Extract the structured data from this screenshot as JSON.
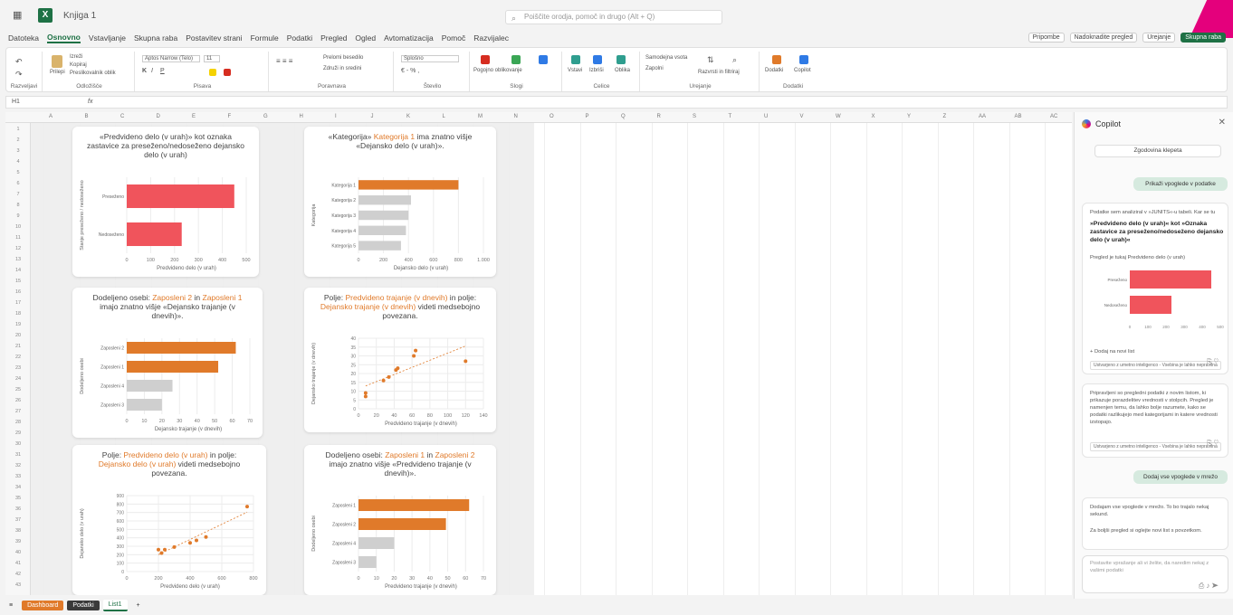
{
  "titlebar": {
    "title": "Knjiga 1",
    "search_placeholder": "Poiščite orodja, pomoč in drugo (Alt + Q)"
  },
  "menu": [
    "Datoteka",
    "Osnovno",
    "Vstavljanje",
    "Skupna raba",
    "Postavitev strani",
    "Formule",
    "Podatki",
    "Pregled",
    "Ogled",
    "Avtomatizacija",
    "Pomoč",
    "Razvijalec"
  ],
  "menu_right": {
    "comments": "Pripombe",
    "catchup": "Nadoknadite pregled",
    "editing": "Urejanje",
    "share": "Skupna raba"
  },
  "ribbon": {
    "groups": [
      "Razveljavi",
      "Odložišče",
      "Pisava",
      "Poravnava",
      "Število",
      "Slogi",
      "Celice",
      "Urejanje",
      "Dodatki"
    ],
    "font_name": "Aptos Narrow (Telo)",
    "font_size": "11",
    "number_format": "Splošno",
    "labels": {
      "paste": "Prilepi",
      "cut": "Izreži",
      "copy": "Kopiraj",
      "format_painter": "Preslikovalnik oblik",
      "wrap": "Prelomi besedilo",
      "merge": "Združi in sredini",
      "cond_format": "Pogojno oblikovanje",
      "format_table": "Oblikuj kot tabelo",
      "cell_styles": "Slogi celic",
      "insert": "Vstavi",
      "delete": "Izbriši",
      "format": "Oblika",
      "autosum": "Samodejna vsota",
      "fill": "Zapolni",
      "sort": "Razvrsti in filtriraj",
      "find": "Najdi in izberi",
      "addins": "Dodatki",
      "copilot": "Copilot"
    }
  },
  "formula_bar": {
    "cell_ref": "H1",
    "fx": "fx"
  },
  "columns": [
    "A",
    "B",
    "C",
    "D",
    "E",
    "F",
    "G",
    "H",
    "I",
    "J",
    "K",
    "L",
    "M",
    "N",
    "O",
    "P",
    "Q",
    "R",
    "S",
    "T",
    "U",
    "V",
    "W",
    "X",
    "Y",
    "Z",
    "AA",
    "AB",
    "AC"
  ],
  "charts": [
    {
      "title_parts": [
        {
          "t": "«Predvideno delo (v urah)» kot oznaka zastavice za preseženo/nedoseženo dejansko delo (v urah)",
          "hl": false
        }
      ],
      "type": "bar",
      "categories": [
        "Preseženo",
        "Nedoseženo"
      ],
      "values": [
        450,
        230
      ],
      "colors": [
        "#f0545c",
        "#f0545c"
      ],
      "xticks": [
        "0",
        "100",
        "200",
        "300",
        "400",
        "500"
      ],
      "xmax": 500,
      "xlabel": "Predvideno delo (v urah)",
      "ylabel": "Stanje preseženo / nedoseženo"
    },
    {
      "title_parts": [
        {
          "t": "«Kategorija» ",
          "hl": false
        },
        {
          "t": "Kategorija 1",
          "hl": true
        },
        {
          "t": " ima znatno višje «Dejansko delo (v urah)».",
          "hl": false
        }
      ],
      "type": "bar",
      "categories": [
        "Kategorija 1",
        "Kategorija 2",
        "Kategorija 3",
        "Kategorija 4",
        "Kategorija 5"
      ],
      "values": [
        800,
        420,
        400,
        380,
        340
      ],
      "colors": [
        "#e07a2a",
        "#cfcfcf",
        "#cfcfcf",
        "#cfcfcf",
        "#cfcfcf"
      ],
      "xticks": [
        "0",
        "200",
        "400",
        "600",
        "800",
        "1.000"
      ],
      "xmax": 1000,
      "xlabel": "Dejansko delo (v urah)",
      "ylabel": "Kategorija"
    },
    {
      "title_parts": [
        {
          "t": "Dodeljeno osebi: ",
          "hl": false
        },
        {
          "t": "Zaposleni 2",
          "hl": true
        },
        {
          "t": " in ",
          "hl": false
        },
        {
          "t": "Zaposleni 1",
          "hl": true
        },
        {
          "t": " imajo znatno višje «Dejansko trajanje (v dnevih)».",
          "hl": false
        }
      ],
      "type": "bar",
      "categories": [
        "Zaposleni 2",
        "Zaposleni 1",
        "Zaposleni 4",
        "Zaposleni 3"
      ],
      "values": [
        62,
        52,
        26,
        20
      ],
      "colors": [
        "#e07a2a",
        "#e07a2a",
        "#cfcfcf",
        "#cfcfcf"
      ],
      "xticks": [
        "0",
        "10",
        "20",
        "30",
        "40",
        "50",
        "60",
        "70"
      ],
      "xmax": 70,
      "xlabel": "Dejansko trajanje (v dnevih)",
      "ylabel": "Dodeljeno osebi"
    },
    {
      "title_parts": [
        {
          "t": "Polje: ",
          "hl": false
        },
        {
          "t": "Predvideno trajanje (v dnevih)",
          "hl": true
        },
        {
          "t": " in polje: ",
          "hl": false
        },
        {
          "t": "Dejansko trajanje (v dnevih)",
          "hl": true
        },
        {
          "t": " videti medsebojno povezana.",
          "hl": false
        }
      ],
      "type": "scatter",
      "points": [
        [
          8,
          7
        ],
        [
          8,
          9
        ],
        [
          28,
          16
        ],
        [
          34,
          18
        ],
        [
          42,
          22
        ],
        [
          44,
          23
        ],
        [
          62,
          30
        ],
        [
          64,
          33
        ],
        [
          120,
          27
        ]
      ],
      "xticks": [
        "0",
        "20",
        "40",
        "60",
        "80",
        "100",
        "120",
        "140"
      ],
      "yticks": [
        "0",
        "5",
        "10",
        "15",
        "20",
        "25",
        "30",
        "35",
        "40"
      ],
      "xmax": 140,
      "ymax": 40,
      "xlabel": "Predvideno trajanje (v dnevih)",
      "ylabel": "Dejansko trajanje (v dnevih)"
    },
    {
      "title_parts": [
        {
          "t": "Polje: ",
          "hl": false
        },
        {
          "t": "Predvideno delo (v urah)",
          "hl": true
        },
        {
          "t": " in polje: ",
          "hl": false
        },
        {
          "t": "Dejansko delo (v urah)",
          "hl": true
        },
        {
          "t": " videti medsebojno povezana.",
          "hl": false
        }
      ],
      "type": "scatter",
      "points": [
        [
          200,
          260
        ],
        [
          220,
          220
        ],
        [
          240,
          260
        ],
        [
          300,
          290
        ],
        [
          400,
          340
        ],
        [
          440,
          370
        ],
        [
          500,
          410
        ],
        [
          760,
          770
        ]
      ],
      "xticks": [
        "0",
        "200",
        "400",
        "600",
        "800"
      ],
      "yticks": [
        "0",
        "100",
        "200",
        "300",
        "400",
        "500",
        "600",
        "700",
        "800",
        "900"
      ],
      "xmax": 800,
      "ymax": 900,
      "xlabel": "Predvideno delo (v urah)",
      "ylabel": "Dejansko delo (v urah)"
    },
    {
      "title_parts": [
        {
          "t": "Dodeljeno osebi: ",
          "hl": false
        },
        {
          "t": "Zaposleni 1",
          "hl": true
        },
        {
          "t": " in ",
          "hl": false
        },
        {
          "t": "Zaposleni 2",
          "hl": true
        },
        {
          "t": " imajo znatno višje «Predvideno trajanje (v dnevih)».",
          "hl": false
        }
      ],
      "type": "bar",
      "categories": [
        "Zaposleni 1",
        "Zaposleni 2",
        "Zaposleni 4",
        "Zaposleni 3"
      ],
      "values": [
        62,
        49,
        20,
        10
      ],
      "colors": [
        "#e07a2a",
        "#e07a2a",
        "#cfcfcf",
        "#cfcfcf"
      ],
      "xticks": [
        "0",
        "10",
        "20",
        "30",
        "40",
        "50",
        "60",
        "70"
      ],
      "xmax": 70,
      "xlabel": "Predvideno trajanje (v dnevih)",
      "ylabel": "Dodeljeno osebi"
    }
  ],
  "copilot": {
    "title": "Copilot",
    "new_chat": "Zgodovina klepeta",
    "user1": "Prikaži vpoglede v podatke",
    "card1_intro": "Podatke sem analiziral v »JUNITS«-u tabeli. Kar se tu",
    "card1_bold": "»Predvideno delo (v urah)« kot »Oznaka zastavice za preseženo/nedoseženo dejansko delo (v urah)«",
    "card1_sub": "Pregled je tukaj Predvideno delo (v urah)",
    "card1_add": "+ Dodaj na novi list",
    "card1_tag": "Ustvarjeno z umetno inteligenco - Vsebina je lahko nepravilna",
    "card2_text": "Pripravljeni so pregledni podatki z novim listom, ki prikazuje porazdelitev vrednosti v stolpcih. Pregled je namenjen temu, da lahko bolje razumete, kako se podatki razlikujejo med kategorijami in katere vrednosti izstopajo.",
    "card2_tag": "Ustvarjeno z umetno inteligenco - Vsebina je lahko nepravilna",
    "user2": "Dodaj vse vpoglede v mrežo",
    "card3_p1": "Dodajam vse vpoglede v mrežo. To bo trajalo nekaj sekund.",
    "card3_p2": "Za boljši pregled si oglejte novi list s povzetkom.",
    "input_placeholder": "Postavite vprašanje ali vi želite, da naredim nekaj z vašimi podatki",
    "mini_categories": [
      "Preseženo",
      "Nedoseženo"
    ],
    "mini_values": [
      450,
      230
    ],
    "mini_ticks": [
      "0",
      "100",
      "200",
      "300",
      "400",
      "500"
    ]
  },
  "sheet_tabs": [
    "Dashboard",
    "Podatki",
    "List1"
  ]
}
